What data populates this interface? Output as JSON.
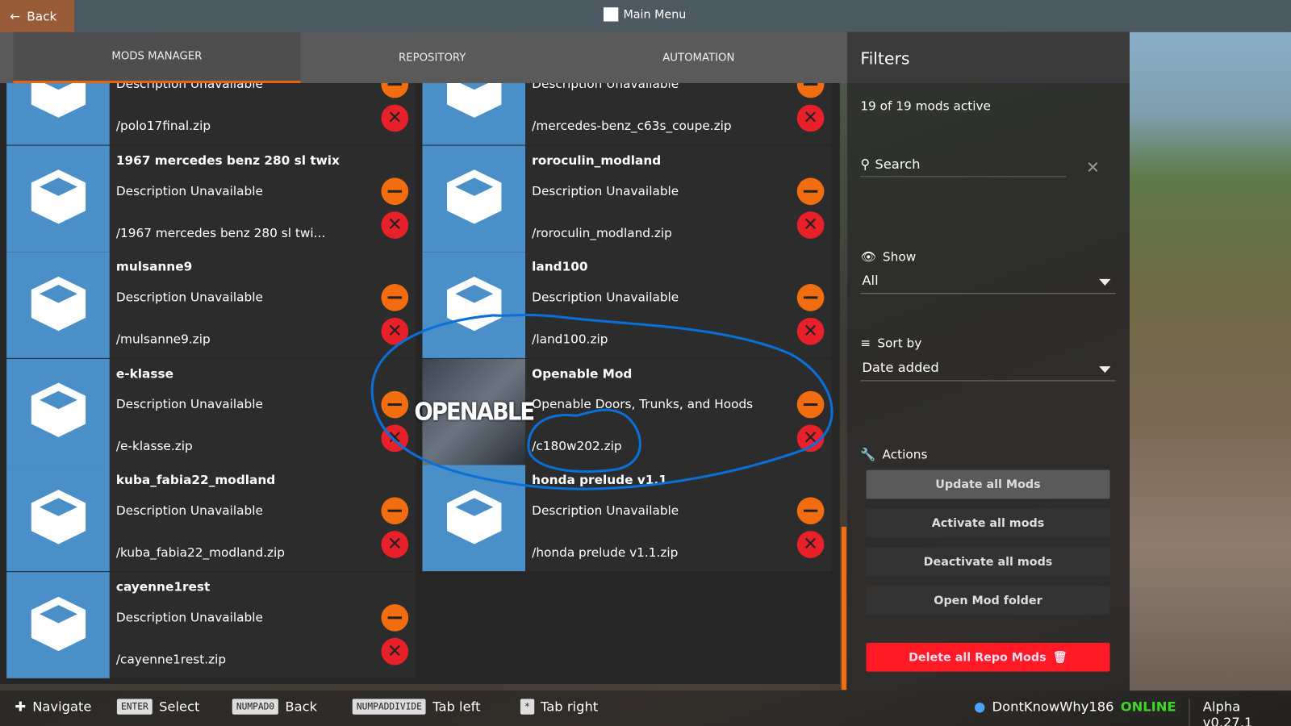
{
  "topbar": {
    "back_label": "Back",
    "title": "Main Menu"
  },
  "tabs": [
    {
      "label": "MODS MANAGER",
      "active": true
    },
    {
      "label": "REPOSITORY"
    },
    {
      "label": "AUTOMATION"
    }
  ],
  "mods": [
    {
      "name": "",
      "desc": "Description Unavailable",
      "file": "/polo17final.zip"
    },
    {
      "name": "",
      "desc": "Description Unavailable",
      "file": "/mercedes-benz_c63s_coupe.zip"
    },
    {
      "name": "1967 mercedes benz 280 sl twix",
      "desc": "Description Unavailable",
      "file": "/1967 mercedes benz 280 sl twi..."
    },
    {
      "name": "roroculin_modland",
      "desc": "Description Unavailable",
      "file": "/roroculin_modland.zip"
    },
    {
      "name": "mulsanne9",
      "desc": "Description Unavailable",
      "file": "/mulsanne9.zip"
    },
    {
      "name": "land100",
      "desc": "Description Unavailable",
      "file": "/land100.zip"
    },
    {
      "name": "e-klasse",
      "desc": "Description Unavailable",
      "file": "/e-klasse.zip"
    },
    {
      "name": "Openable Mod",
      "desc": "Openable Doors, Trunks, and Hoods",
      "file": "/c180w202.zip",
      "thumb_text": "OPENABLE"
    },
    {
      "name": "kuba_fabia22_modland",
      "desc": "Description Unavailable",
      "file": "/kuba_fabia22_modland.zip"
    },
    {
      "name": "honda prelude v1.1",
      "desc": "Description Unavailable",
      "file": "/honda prelude v1.1.zip"
    },
    {
      "name": "cayenne1rest",
      "desc": "Description Unavailable",
      "file": "/cayenne1rest.zip"
    }
  ],
  "filters": {
    "title": "Filters",
    "active_count": "19 of 19 mods active",
    "search_placeholder": "Search",
    "show_label": "Show",
    "show_value": "All",
    "sort_label": "Sort by",
    "sort_value": "Date added",
    "actions_label": "Actions",
    "actions": [
      "Update all Mods",
      "Activate all mods",
      "Deactivate all mods",
      "Open Mod folder"
    ],
    "delete_label": "Delete all Repo Mods"
  },
  "bottom": {
    "navigate": "Navigate",
    "hints": [
      {
        "key": "ENTER",
        "label": "Select"
      },
      {
        "key": "NUMPAD0",
        "label": "Back"
      },
      {
        "key": "NUMPADDIVIDE",
        "label": "Tab left"
      },
      {
        "key": "*",
        "label": "Tab right"
      }
    ],
    "user": "DontKnowWhy186",
    "status": "ONLINE",
    "version": "Alpha v0.27.1"
  },
  "colors": {
    "accent": "#f26d0f",
    "danger": "#ff1a25",
    "thumb": "#4b8fc8",
    "online": "#3fd42a",
    "annotation": "#0a6fd6"
  }
}
